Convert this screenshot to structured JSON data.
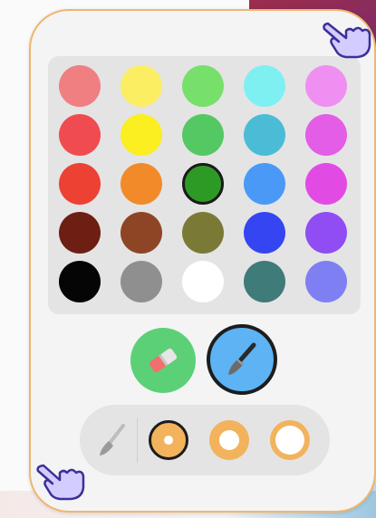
{
  "palette": {
    "rows": [
      [
        "#f07f82",
        "#fbee63",
        "#76e06b",
        "#7ef0f2",
        "#f08ff2"
      ],
      [
        "#ef4b50",
        "#fbee21",
        "#54c862",
        "#4bbcd6",
        "#e35de6"
      ],
      [
        "#ec4133",
        "#f28a2a",
        "#2e9a26",
        "#4b99f7",
        "#e14be4"
      ],
      [
        "#6c1f12",
        "#8e4526",
        "#7a7a36",
        "#3545f2",
        "#8f4df3"
      ],
      [
        "#050505",
        "#8f8f8f",
        "#ffffff",
        "#3f7b78",
        "#7f7ff4"
      ]
    ],
    "selected": {
      "row": 2,
      "col": 2
    }
  },
  "tools": {
    "eraser_color": "#5cd077",
    "brush_color": "#5db3f4",
    "active": "brush"
  },
  "brush_sizes": {
    "accent": "#f2b35c",
    "options": [
      "small",
      "medium",
      "large"
    ],
    "selected": "small"
  },
  "theme": {
    "panel_border": "#f0b56f",
    "cursor_icon": "pointing-hand-icon"
  }
}
